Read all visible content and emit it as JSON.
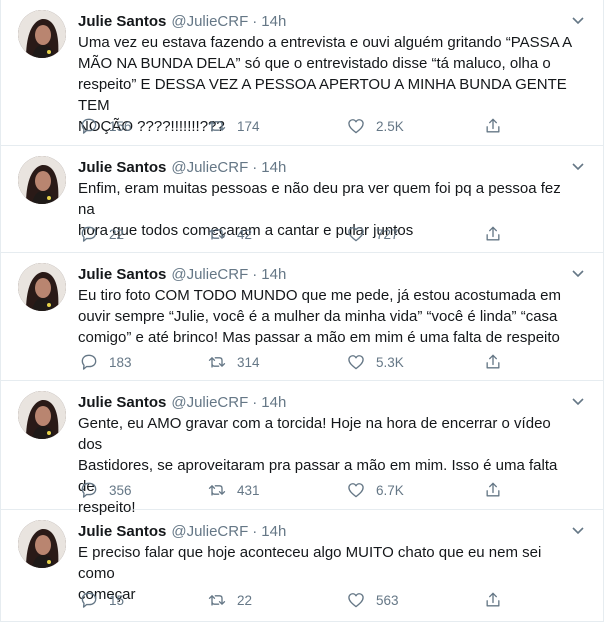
{
  "tweets": [
    {
      "name": "Julie Santos",
      "handle": "@JulieCRF",
      "dot": "·",
      "time": "14h",
      "text": "Uma vez eu estava fazendo a entrevista e ouvi alguém gritando “PASSA A\nMÃO NA BUNDA DELA” só que o entrevistado disse “tá maluco, olha o\nrespeito” E DESSA VEZ A PESSOA APERTOU A MINHA BUNDA GENTE TEM\nNOÇÃO ????!!!!!!!???",
      "replies": "156",
      "retweets": "174",
      "likes": "2.5K"
    },
    {
      "name": "Julie Santos",
      "handle": "@JulieCRF",
      "dot": "·",
      "time": "14h",
      "text": "Enfim, eram muitas pessoas e não deu pra ver quem foi pq a pessoa fez na\nhora que todos começaram a cantar e pular juntos",
      "replies": "22",
      "retweets": "42",
      "likes": "727"
    },
    {
      "name": "Julie Santos",
      "handle": "@JulieCRF",
      "dot": "·",
      "time": "14h",
      "text": "Eu tiro foto COM TODO MUNDO que me pede, já estou acostumada em\nouvir sempre “Julie, você é a mulher da minha vida” “você é linda” “casa\ncomigo” e até brinco! Mas passar a mão em mim é uma falta de respeito",
      "replies": "183",
      "retweets": "314",
      "likes": "5.3K"
    },
    {
      "name": "Julie Santos",
      "handle": "@JulieCRF",
      "dot": "·",
      "time": "14h",
      "text": "Gente, eu AMO gravar com a torcida! Hoje na hora de encerrar o vídeo dos\nBastidores, se aproveitaram pra passar a mão em mim. Isso é uma falta de\nrespeito!",
      "replies": "356",
      "retweets": "431",
      "likes": "6.7K"
    },
    {
      "name": "Julie Santos",
      "handle": "@JulieCRF",
      "dot": "·",
      "time": "14h",
      "text": "E preciso falar que hoje aconteceu algo MUITO chato que eu nem sei como\ncomeçar",
      "replies": "15",
      "retweets": "22",
      "likes": "563"
    }
  ],
  "icons": {
    "reply": "reply-icon",
    "retweet": "retweet-icon",
    "like": "heart-icon",
    "share": "share-icon",
    "menu": "chevron-down-icon"
  },
  "colors": {
    "text": "#14171a",
    "muted": "#657786",
    "divider": "#e6ecf0"
  }
}
